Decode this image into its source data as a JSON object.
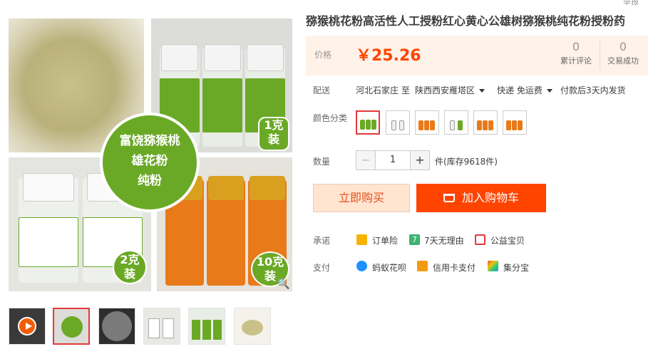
{
  "report": "举报",
  "product": {
    "title": "猕猴桃花粉高活性人工授粉红心黄心公雄树猕猴桃纯花粉授粉药"
  },
  "main_image": {
    "badge_lines": [
      "富饶猕猴桃",
      "雄花粉",
      "纯粉"
    ],
    "label_1g": [
      "1克",
      "装"
    ],
    "label_2g": [
      "2克",
      "装"
    ],
    "label_10g": [
      "10克",
      "装"
    ]
  },
  "price": {
    "label": "价格",
    "value": "￥25.26",
    "reviews_count": "0",
    "reviews_label": "累计评论",
    "sales_count": "0",
    "sales_label": "交易成功"
  },
  "shipping": {
    "label": "配送",
    "from": "河北石家庄 至",
    "to": "陕西西安雁塔区",
    "method": "快递 免运费",
    "note": "付款后3天内发货"
  },
  "color": {
    "label": "颜色分类",
    "options": 6
  },
  "quantity": {
    "label": "数量",
    "value": "1",
    "minus": "−",
    "plus": "+",
    "stock": "件(库存9618件)"
  },
  "actions": {
    "buy_now": "立即购买",
    "add_to_cart": "加入购物车"
  },
  "promise": {
    "label": "承诺",
    "items": [
      "订单险",
      "7天无理由",
      "公益宝贝"
    ],
    "icon_seven": "7"
  },
  "payment": {
    "label": "支付",
    "items": [
      "蚂蚁花呗",
      "信用卡支付",
      "集分宝"
    ]
  },
  "colors": {
    "accent": "#ff4400",
    "price": "#ff4400",
    "green": "#6aa926",
    "orange_bottle": "#e87a1a"
  }
}
